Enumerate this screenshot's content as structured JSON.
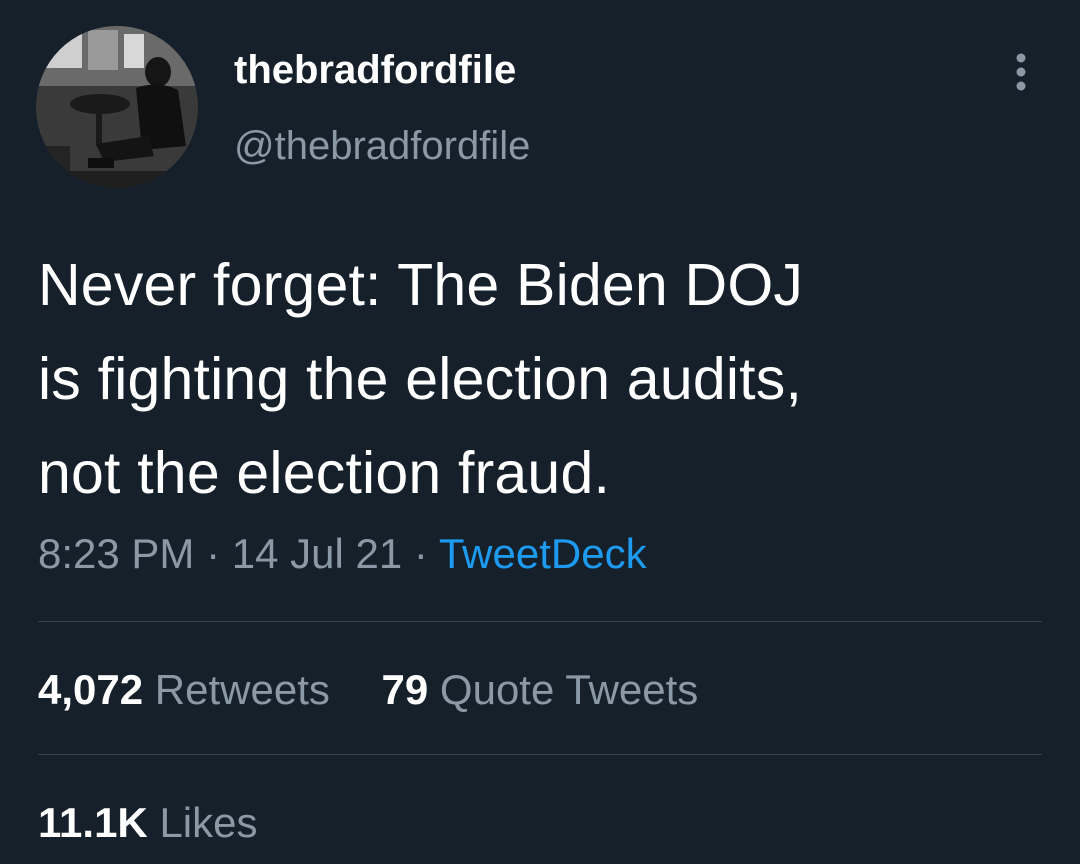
{
  "author": {
    "display_name": "thebradfordfile",
    "handle": "@thebradfordfile"
  },
  "icons": {
    "menu": "more-vertical-icon",
    "avatar": "profile-photo"
  },
  "tweet": {
    "text_lines": [
      "Never forget: The Biden DOJ",
      "is fighting the election audits,",
      "not the election fraud."
    ],
    "time": "8:23 PM",
    "separator": "·",
    "date": "14 Jul 21",
    "source": "TweetDeck"
  },
  "stats": {
    "retweets_count": "4,072",
    "retweets_label": "Retweets",
    "quotes_count": "79",
    "quotes_label": "Quote Tweets",
    "likes_count": "11.1K",
    "likes_label": "Likes"
  },
  "colors": {
    "background": "#15202b",
    "primary_text": "#ffffff",
    "secondary_text": "#8b98a5",
    "link": "#1d9bf0",
    "divider": "#38444d"
  }
}
